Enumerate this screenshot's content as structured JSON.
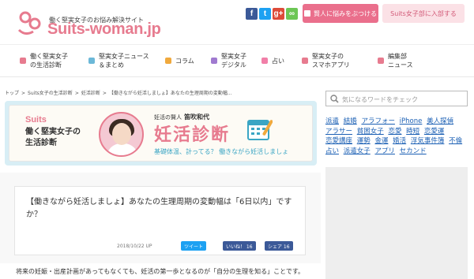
{
  "header": {
    "tagline": "働く堅実女子のお悩み解決サイト",
    "logo": "Suits-woman.jp",
    "social": [
      {
        "icon": "facebook-icon",
        "glyph": "f",
        "color": "#3b5998"
      },
      {
        "icon": "twitter-icon",
        "glyph": "t",
        "color": "#1da1f2"
      },
      {
        "icon": "google-plus-icon",
        "glyph": "g+",
        "color": "#dd4b39"
      },
      {
        "icon": "feedly-icon",
        "glyph": "∞",
        "color": "#6cc655"
      }
    ],
    "cta_consult": "賢人に悩みをぶつける",
    "cta_join": "Suits女子部に入部する"
  },
  "nav": [
    {
      "label": "働く堅実女子\nの生活診断",
      "icon": "diagnosis-icon",
      "color": "#e77b8f"
    },
    {
      "label": "堅実女子ニュース\n＆まとめ",
      "icon": "news-icon",
      "color": "#6cb8d8"
    },
    {
      "label": "コラム",
      "icon": "column-icon",
      "color": "#f0a93d"
    },
    {
      "label": "堅実女子\nデジタル",
      "icon": "digital-icon",
      "color": "#a07ad0"
    },
    {
      "label": "占い",
      "icon": "fortune-icon",
      "color": "#f17fa8"
    },
    {
      "label": "堅実女子の\nスマホアプリ",
      "icon": "smartphone-icon",
      "color": "#e77b8f"
    },
    {
      "label": "編集部\nニュース",
      "icon": "editorial-icon",
      "color": "#e77b8f"
    }
  ],
  "breadcrumb": [
    "トップ",
    ">",
    "Suits女子の生活診断",
    ">",
    "妊活診断",
    ">",
    "【働きながら妊活しましょ】あなたの生理周期の変動幅..."
  ],
  "banner": {
    "brand": "Suits",
    "series": "働く堅実女子の生活診断",
    "by_label": "妊活の賢人",
    "author": "笛吹和代",
    "title": "妊活診断",
    "subtitle": "基礎体温、計ってる？ 働きながら妊活しましょ"
  },
  "article": {
    "title": "【働きながら妊活しましょ】あなたの生理周期の変動幅は「6日以内」ですか？",
    "date": "2018/10/22 UP",
    "tweet": "ツイート",
    "like": "いいね！ 16",
    "share": "シェア 16",
    "lead": "将来の妊娠・出産計画があってもなくても、妊活の第一歩となるのが「自分の生理を知る」ことです。"
  },
  "sidebar": {
    "search_placeholder": "気になるワードをチェック",
    "tags": [
      "派遣",
      "結婚",
      "アラフォー",
      "iPhone",
      "美人探偵",
      "アラサー",
      "貧困女子",
      "恋愛",
      "時短",
      "恋愛運",
      "恋愛講座",
      "運勢",
      "金運",
      "婚活",
      "浮気事件簿",
      "不倫",
      "占い",
      "派遣女子",
      "アプリ",
      "セカンド"
    ]
  },
  "colors": {
    "brand": "#e77b8f",
    "accent_blue": "#3aa5c4",
    "link": "#1a5fb4"
  }
}
